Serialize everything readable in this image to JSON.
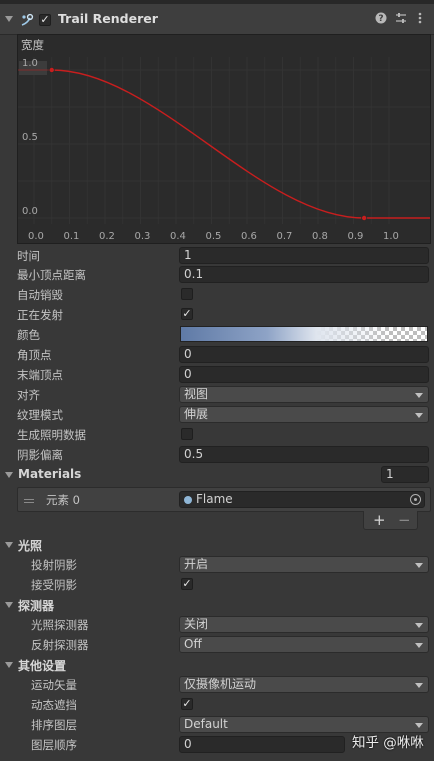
{
  "component": {
    "title": "Trail Renderer",
    "enabled": true,
    "header_icons": [
      "help-icon",
      "preset-icon",
      "more-icon"
    ]
  },
  "width_curve": {
    "label": "宽度",
    "value_box": "1.0",
    "y_ticks": [
      "1.0",
      "0.5",
      "0.0"
    ],
    "x_ticks": [
      "0.0",
      "0.1",
      "0.2",
      "0.3",
      "0.4",
      "0.5",
      "0.6",
      "0.7",
      "0.8",
      "0.9",
      "1.0"
    ],
    "keys": [
      [
        0.05,
        1.0
      ],
      [
        0.93,
        0.0
      ]
    ],
    "curve_color": "#c81e1e",
    "grid_color": "#333333"
  },
  "props": {
    "time": {
      "label": "时间",
      "value": "1"
    },
    "min_vertex_distance": {
      "label": "最小顶点距离",
      "value": "0.1"
    },
    "autodestruct": {
      "label": "自动销毁",
      "checked": false
    },
    "emitting": {
      "label": "正在发射",
      "checked": true
    },
    "color": {
      "label": "颜色",
      "gradient_start": "#5f7aa6",
      "gradient_end": "#ffffff"
    },
    "corner_vertices": {
      "label": "角顶点",
      "value": "0"
    },
    "end_cap_vertices": {
      "label": "末端顶点",
      "value": "0"
    },
    "alignment": {
      "label": "对齐",
      "value": "视图"
    },
    "texture_mode": {
      "label": "纹理模式",
      "value": "伸展"
    },
    "generate_lighting_data": {
      "label": "生成照明数据",
      "checked": false
    },
    "shadow_bias": {
      "label": "阴影偏离",
      "value": "0.5"
    }
  },
  "materials": {
    "label": "Materials",
    "count": "1",
    "element_label": "元素 0",
    "element_value": "Flame",
    "add": "+",
    "remove": "−"
  },
  "lighting": {
    "header": "光照",
    "cast_shadows": {
      "label": "投射阴影",
      "value": "开启"
    },
    "receive_shadows": {
      "label": "接受阴影",
      "checked": true
    }
  },
  "probes": {
    "header": "探测器",
    "light_probes": {
      "label": "光照探测器",
      "value": "关闭"
    },
    "reflection_probes": {
      "label": "反射探测器",
      "value": "Off"
    }
  },
  "other": {
    "header": "其他设置",
    "motion_vectors": {
      "label": "运动矢量",
      "value": "仅摄像机运动"
    },
    "dynamic_occlusion": {
      "label": "动态遮挡",
      "checked": true
    },
    "sorting_layer": {
      "label": "排序图层",
      "value": "Default"
    },
    "order_in_layer": {
      "label": "图层顺序",
      "value": "0"
    }
  },
  "watermark": "知乎 @咻咻"
}
